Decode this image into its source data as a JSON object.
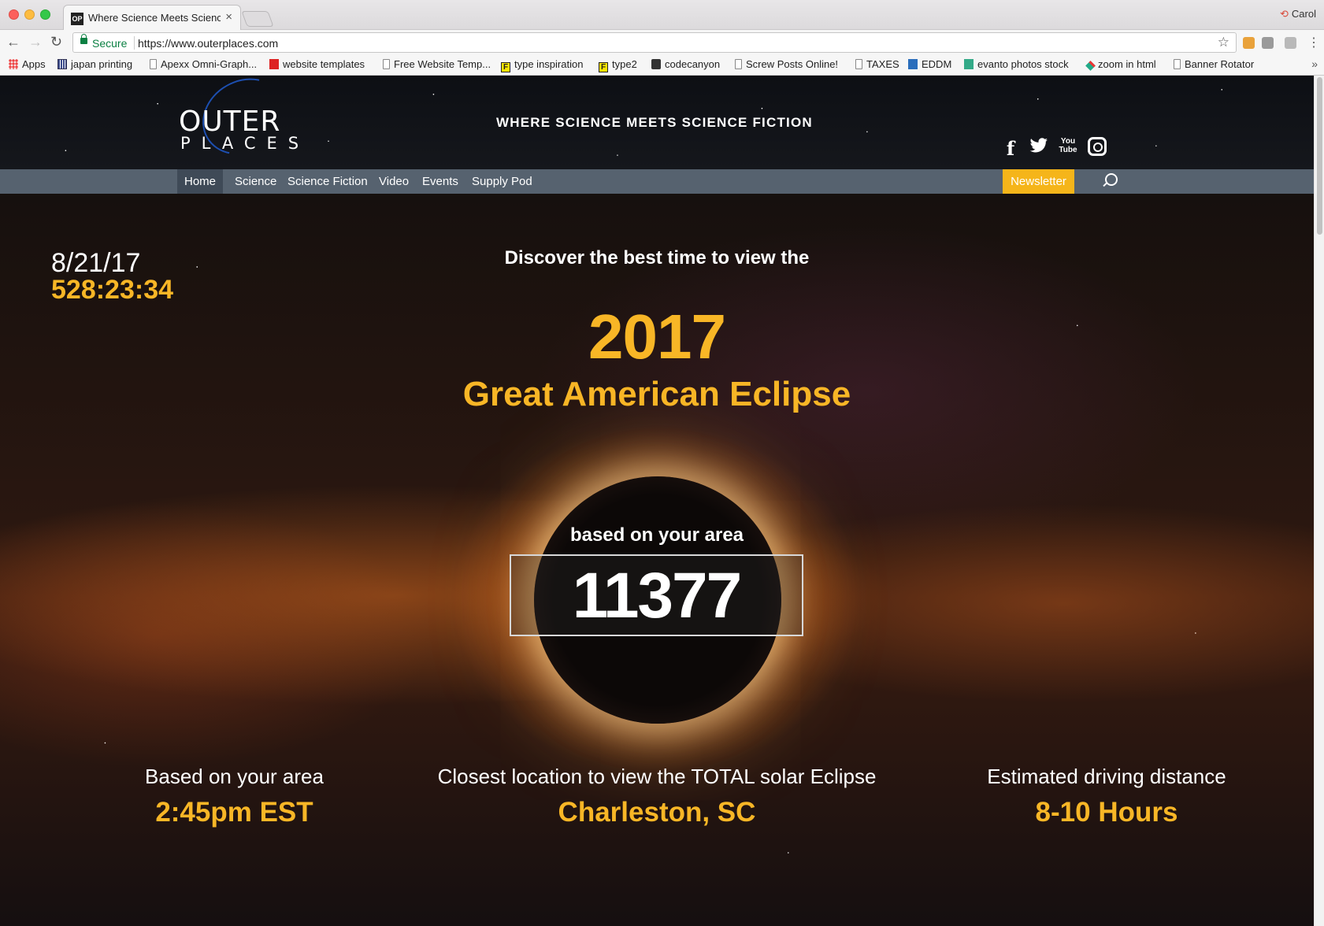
{
  "browser": {
    "tab_title": "Where Science Meets Science Fiction",
    "tab_favicon": "OP",
    "profile_name": "Carol",
    "secure_label": "Secure",
    "url": "https://www.outerplaces.com",
    "bookmarks": [
      {
        "label": "Apps",
        "icon": "apps-grid-icon"
      },
      {
        "label": "japan printing",
        "icon": "grid-favicon"
      },
      {
        "label": "Apexx Omni-Graph...",
        "icon": "page-icon"
      },
      {
        "label": "website templates",
        "icon": "red-favicon"
      },
      {
        "label": "Free Website Temp...",
        "icon": "page-icon"
      },
      {
        "label": "type inspiration",
        "icon": "f-favicon"
      },
      {
        "label": "type2",
        "icon": "f-favicon"
      },
      {
        "label": "codecanyon",
        "icon": "dark-favicon"
      },
      {
        "label": "Screw Posts Online!",
        "icon": "page-icon"
      },
      {
        "label": "TAXES",
        "icon": "page-icon"
      },
      {
        "label": "EDDM",
        "icon": "blue-favicon"
      },
      {
        "label": "evanto photos stock",
        "icon": "green-favicon"
      },
      {
        "label": "zoom in html",
        "icon": "diamond-favicon"
      },
      {
        "label": "Banner Rotator",
        "icon": "page-icon"
      }
    ],
    "more_label": "»"
  },
  "site": {
    "logo_top": "OUTER",
    "logo_bottom": "PLACES",
    "tagline": "WHERE SCIENCE MEETS SCIENCE FICTION",
    "social": [
      "facebook-icon",
      "twitter-icon",
      "youtube-icon",
      "instagram-icon"
    ],
    "nav": [
      "Home",
      "Science",
      "Science Fiction",
      "Video",
      "Events",
      "Supply Pod"
    ],
    "newsletter_label": "Newsletter"
  },
  "hero": {
    "date": "8/21/17",
    "countdown": "528:23:34",
    "intro": "Discover the best time to view the",
    "year": "2017",
    "event_title": "Great American Eclipse",
    "area_label": "based on your area",
    "zip": "11377",
    "time_label": "Based on your area",
    "time_value": "2:45pm EST",
    "location_label": "Closest location to view the TOTAL solar Eclipse",
    "location_value": "Charleston, SC",
    "drive_label": "Estimated driving distance",
    "drive_value": "8-10 Hours"
  },
  "colors": {
    "accent": "#f8b626",
    "nav_bg": "#56626f",
    "newsletter_bg": "#f5b51a"
  }
}
